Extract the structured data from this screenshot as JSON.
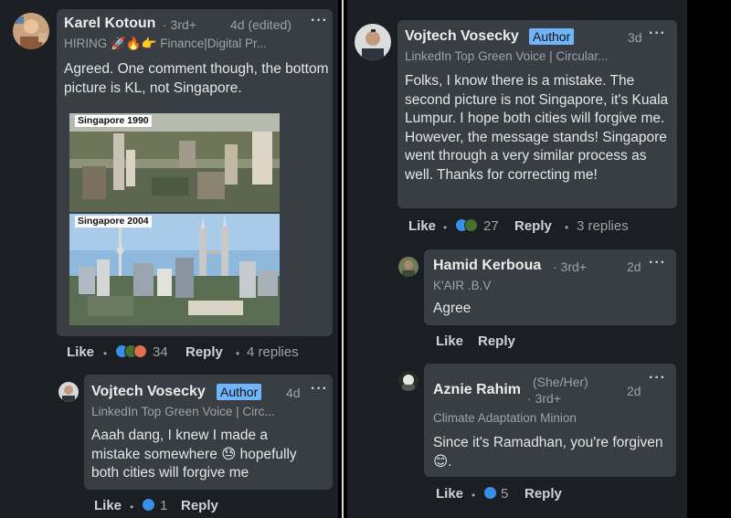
{
  "left": {
    "comment1": {
      "name": "Karel Kotoun",
      "degree": "· 3rd+",
      "time": "4d (edited)",
      "headline_prefix": "HIRING",
      "headline_suffix": "Finance|Digital Pr...",
      "text": "Agreed. One comment though, the bottom picture is KL, not Singapore.",
      "photo_top_label": "Singapore 1990",
      "photo_bottom_label": "Singapore 2004",
      "like": "Like",
      "reaction_count": "34",
      "reply": "Reply",
      "replies": "4 replies"
    },
    "reply1": {
      "name": "Vojtech Vosecky",
      "badge": "Author",
      "time": "4d",
      "headline": "LinkedIn Top Green Voice | Circ...",
      "text_line1": "Aaah dang, I knew I made a",
      "text_line2a": "mistake somewhere",
      "text_line2b": "hopefully",
      "text_line3": "both cities will forgive me",
      "like": "Like",
      "reaction_count": "1",
      "reply": "Reply"
    }
  },
  "right": {
    "post": {
      "name": "Vojtech Vosecky",
      "badge": "Author",
      "time": "3d",
      "headline": "LinkedIn Top Green Voice | Circular...",
      "text": "Folks, I know there is a mistake. The second picture is not Singapore, it's Kuala Lumpur. I hope both cities will forgive me. However, the message stands!  Singapore went through a very similar process as well. Thanks for correcting me!",
      "like": "Like",
      "reaction_count": "27",
      "reply": "Reply",
      "replies": "3 replies"
    },
    "reply_hamid": {
      "name": "Hamid Kerboua",
      "degree": "· 3rd+",
      "time": "2d",
      "headline": "K'AIR .B.V",
      "text": "Agree",
      "like": "Like",
      "reply": "Reply"
    },
    "reply_aznie": {
      "name": "Aznie Rahim",
      "pronouns": "(She/Her)",
      "degree": "· 3rd+",
      "time": "2d",
      "headline": "Climate Adaptation Minion",
      "text": "Since it's Ramadhan, you're forgiven",
      "text_end": ".",
      "like": "Like",
      "reaction_count": "5",
      "reply": "Reply"
    }
  },
  "menu_glyph": "···",
  "dot_glyph": "•",
  "colors": {
    "background": "#1b1f23",
    "bubble": "#383e44",
    "author_badge": "#70b5f9",
    "like_blue": "#378fe9",
    "celebrate_green": "#44712e",
    "love_red": "#df704d"
  },
  "icons": [
    "rocket-emoji",
    "fire-emoji",
    "pointing-hand-emoji",
    "sweat-smile-emoji",
    "smile-emoji",
    "like-reaction-icon",
    "celebrate-reaction-icon",
    "love-reaction-icon",
    "overflow-menu-icon"
  ]
}
